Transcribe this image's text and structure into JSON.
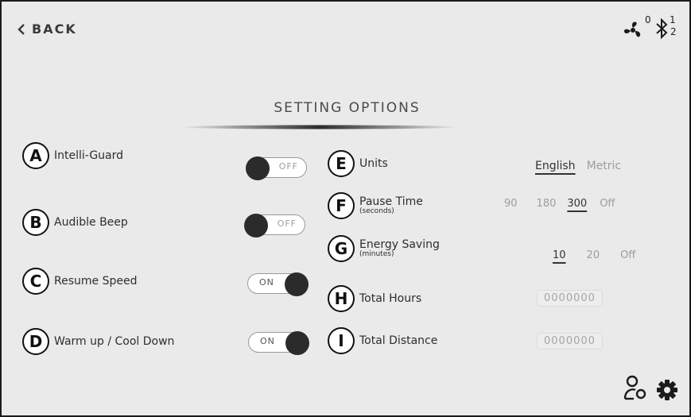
{
  "header": {
    "back_label": "BACK",
    "fan_count": "0",
    "bt_top": "1",
    "bt_bottom": "2"
  },
  "title": "SETTING OPTIONS",
  "left_settings": [
    {
      "letter": "A",
      "label": "Intelli-Guard",
      "state": "OFF"
    },
    {
      "letter": "B",
      "label": "Audible Beep",
      "state": "OFF"
    },
    {
      "letter": "C",
      "label": "Resume Speed",
      "state": "ON"
    },
    {
      "letter": "D",
      "label": "Warm up / Cool Down",
      "state": "ON"
    }
  ],
  "right_settings": {
    "units": {
      "letter": "E",
      "label": "Units",
      "options": [
        "English",
        "Metric"
      ],
      "selected": "English"
    },
    "pause_time": {
      "letter": "F",
      "label": "Pause Time",
      "sublabel": "(seconds)",
      "options": [
        "90",
        "180",
        "300",
        "Off"
      ],
      "selected": "300"
    },
    "energy_saving": {
      "letter": "G",
      "label": "Energy Saving",
      "sublabel": "(minutes)",
      "options": [
        "10",
        "20",
        "Off"
      ],
      "selected": "10"
    },
    "total_hours": {
      "letter": "H",
      "label": "Total Hours",
      "value": "0000000"
    },
    "total_distance": {
      "letter": "I",
      "label": "Total Distance",
      "value": "0000000"
    }
  },
  "icons": {
    "back": "chevron-left-icon",
    "fan": "fan-icon",
    "bluetooth": "bluetooth-icon",
    "user": "user-icon",
    "settings": "gear-icon"
  },
  "colors": {
    "background": "#eaeaea",
    "knob": "#2b2b2b",
    "selected_text": "#333333",
    "muted_text": "#9c9c9c"
  }
}
